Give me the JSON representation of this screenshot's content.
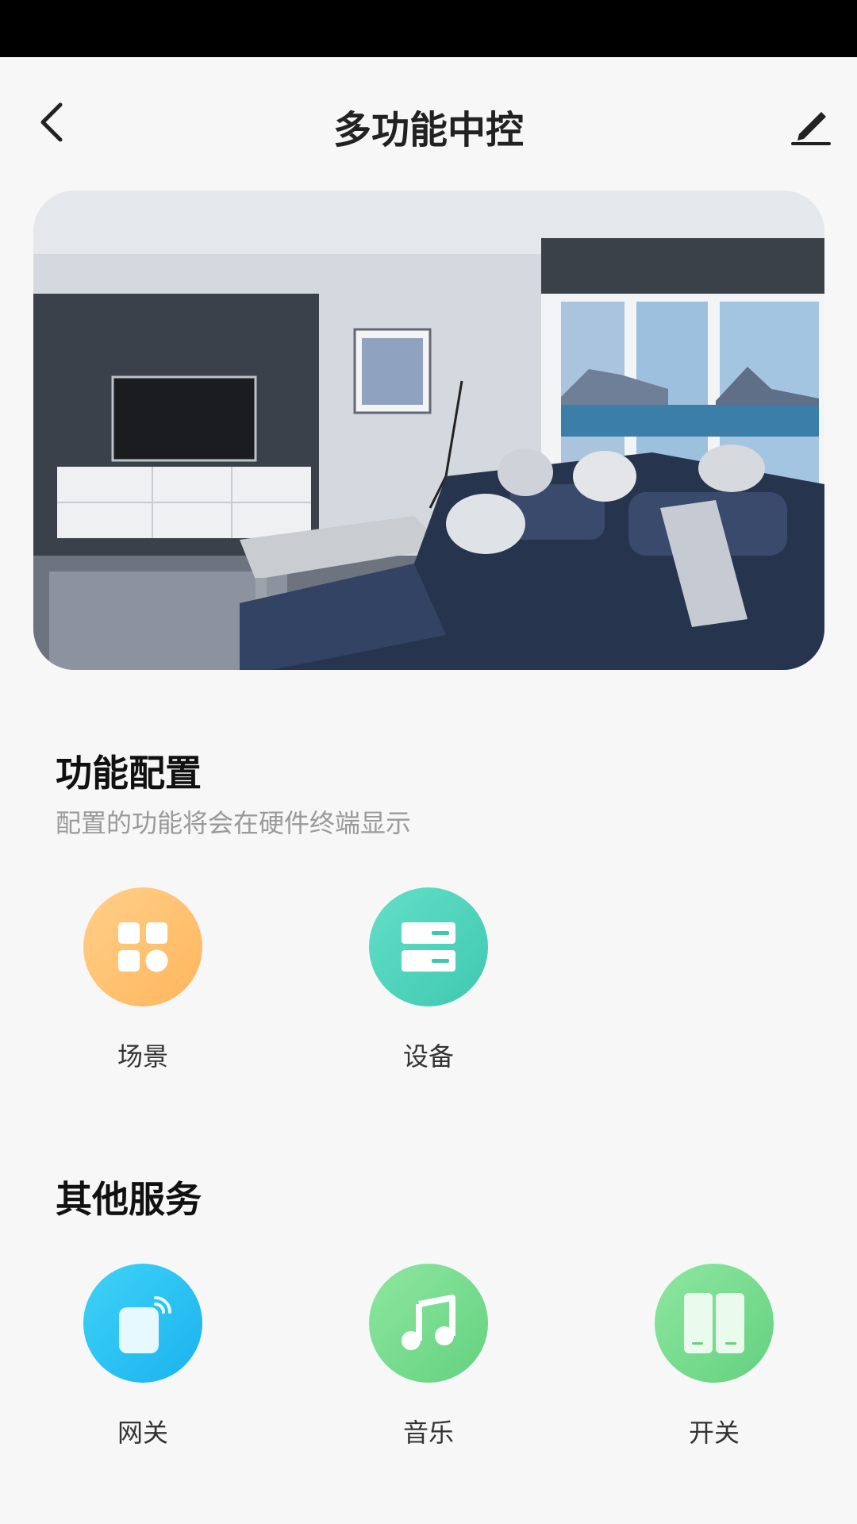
{
  "header": {
    "title": "多功能中控"
  },
  "icons": {
    "back": "chevron-left-icon",
    "edit": "pencil-icon"
  },
  "sections": {
    "config": {
      "title": "功能配置",
      "subtitle": "配置的功能将会在硬件终端显示",
      "items": [
        {
          "label": "场景",
          "icon": "scene-grid-icon",
          "color": "#ffb55b"
        },
        {
          "label": "设备",
          "icon": "device-list-icon",
          "color": "#3fc8b0"
        }
      ]
    },
    "services": {
      "title": "其他服务",
      "items": [
        {
          "label": "网关",
          "icon": "gateway-icon",
          "color": "#1ab2ef"
        },
        {
          "label": "音乐",
          "icon": "music-note-icon",
          "color": "#63d17f"
        },
        {
          "label": "开关",
          "icon": "switch-panel-icon",
          "color": "#63d17f"
        }
      ]
    }
  }
}
